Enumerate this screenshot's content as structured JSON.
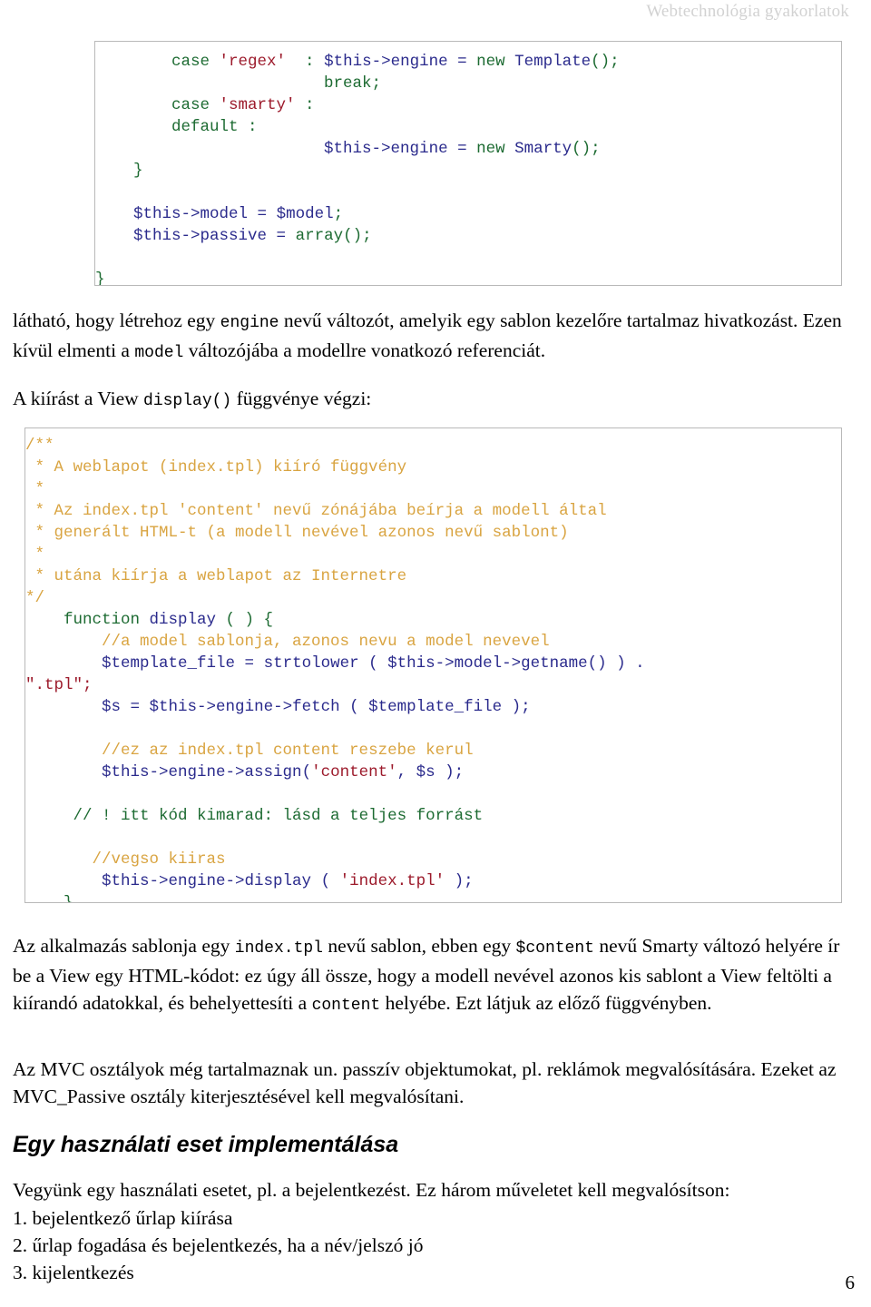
{
  "header": {
    "title": "Webtechnológia gyakorlatok"
  },
  "code_block_1": {
    "lines": [
      [
        {
          "t": "        ",
          "c": "pl"
        },
        {
          "t": "case ",
          "c": "kw"
        },
        {
          "t": "'regex'",
          "c": "str"
        },
        {
          "t": "  : ",
          "c": "kw"
        },
        {
          "t": "$this->engine",
          "c": "var"
        },
        {
          "t": " = ",
          "c": "pl"
        },
        {
          "t": "new ",
          "c": "kw"
        },
        {
          "t": "Template",
          "c": "var"
        },
        {
          "t": "();",
          "c": "kw"
        }
      ],
      [
        {
          "t": "                        ",
          "c": "pl"
        },
        {
          "t": "break;",
          "c": "kw"
        }
      ],
      [
        {
          "t": "        ",
          "c": "pl"
        },
        {
          "t": "case ",
          "c": "kw"
        },
        {
          "t": "'smarty'",
          "c": "str"
        },
        {
          "t": " :",
          "c": "kw"
        }
      ],
      [
        {
          "t": "        ",
          "c": "pl"
        },
        {
          "t": "default :",
          "c": "kw"
        }
      ],
      [
        {
          "t": "                        ",
          "c": "pl"
        },
        {
          "t": "$this->engine",
          "c": "var"
        },
        {
          "t": " = ",
          "c": "pl"
        },
        {
          "t": "new ",
          "c": "kw"
        },
        {
          "t": "Smarty",
          "c": "var"
        },
        {
          "t": "();",
          "c": "kw"
        }
      ],
      [
        {
          "t": "    }",
          "c": "kw"
        }
      ],
      [
        {
          "t": "",
          "c": "pl"
        }
      ],
      [
        {
          "t": "    ",
          "c": "pl"
        },
        {
          "t": "$this->model",
          "c": "var"
        },
        {
          "t": " = ",
          "c": "pl"
        },
        {
          "t": "$model",
          "c": "var"
        },
        {
          "t": ";",
          "c": "kw"
        }
      ],
      [
        {
          "t": "    ",
          "c": "pl"
        },
        {
          "t": "$this->passive",
          "c": "var"
        },
        {
          "t": " = ",
          "c": "pl"
        },
        {
          "t": "array",
          "c": "kw"
        },
        {
          "t": "();",
          "c": "kw"
        }
      ],
      [
        {
          "t": "",
          "c": "pl"
        }
      ],
      [
        {
          "t": "}",
          "c": "kw"
        }
      ]
    ]
  },
  "paragraph_1": {
    "segments": [
      {
        "t": "látható, hogy létrehoz egy ",
        "c": "text"
      },
      {
        "t": "engine",
        "c": "code"
      },
      {
        "t": " nevű változót, amelyik egy sablon kezelőre tartalmaz hivatkozást. Ezen kívül elmenti a ",
        "c": "text"
      },
      {
        "t": "model",
        "c": "code"
      },
      {
        "t": " változójába a modellre vonatkozó referenciát.",
        "c": "text"
      }
    ]
  },
  "paragraph_2": {
    "segments": [
      {
        "t": "A kiírást a View ",
        "c": "text"
      },
      {
        "t": "display()",
        "c": "code"
      },
      {
        "t": " függvénye végzi:",
        "c": "text"
      }
    ]
  },
  "code_block_2": {
    "lines": [
      [
        {
          "t": "/**",
          "c": "com"
        }
      ],
      [
        {
          "t": " * A weblapot (index.tpl) kiíró függvény",
          "c": "com"
        }
      ],
      [
        {
          "t": " *",
          "c": "com"
        }
      ],
      [
        {
          "t": " * Az index.tpl 'content' nevű zónájába beírja a modell által",
          "c": "com"
        }
      ],
      [
        {
          "t": " * generált HTML-t (a modell nevével azonos nevű sablont)",
          "c": "com"
        }
      ],
      [
        {
          "t": " *",
          "c": "com"
        }
      ],
      [
        {
          "t": " * utána kiírja a weblapot az Internetre",
          "c": "com"
        }
      ],
      [
        {
          "t": "*/",
          "c": "com"
        }
      ],
      [
        {
          "t": "    ",
          "c": "pl"
        },
        {
          "t": "function ",
          "c": "kw"
        },
        {
          "t": "display",
          "c": "var"
        },
        {
          "t": " ( ) {",
          "c": "kw"
        }
      ],
      [
        {
          "t": "        ",
          "c": "pl"
        },
        {
          "t": "//a model sablonja, azonos nevu a model nevevel",
          "c": "com"
        }
      ],
      [
        {
          "t": "        ",
          "c": "pl"
        },
        {
          "t": "$template_file",
          "c": "var"
        },
        {
          "t": " = ",
          "c": "pl"
        },
        {
          "t": "strtolower",
          "c": "var"
        },
        {
          "t": " ( ",
          "c": "pl"
        },
        {
          "t": "$this->model->getname",
          "c": "var"
        },
        {
          "t": "() ) .",
          "c": "pl"
        }
      ],
      [
        {
          "t": "\".tpl\";",
          "c": "str"
        }
      ],
      [
        {
          "t": "        ",
          "c": "pl"
        },
        {
          "t": "$s",
          "c": "var"
        },
        {
          "t": " = ",
          "c": "pl"
        },
        {
          "t": "$this->engine->fetch",
          "c": "var"
        },
        {
          "t": " ( ",
          "c": "pl"
        },
        {
          "t": "$template_file",
          "c": "var"
        },
        {
          "t": " );",
          "c": "pl"
        }
      ],
      [
        {
          "t": "",
          "c": "pl"
        }
      ],
      [
        {
          "t": "        ",
          "c": "pl"
        },
        {
          "t": "//ez az index.tpl content reszebe kerul",
          "c": "com"
        }
      ],
      [
        {
          "t": "        ",
          "c": "pl"
        },
        {
          "t": "$this->engine->assign",
          "c": "var"
        },
        {
          "t": "(",
          "c": "pl"
        },
        {
          "t": "'content'",
          "c": "str"
        },
        {
          "t": ", ",
          "c": "pl"
        },
        {
          "t": "$s",
          "c": "var"
        },
        {
          "t": " );",
          "c": "pl"
        }
      ],
      [
        {
          "t": "",
          "c": "pl"
        }
      ],
      [
        {
          "t": "     ",
          "c": "pl"
        },
        {
          "t": "// ! itt kód kimarad: lásd a teljes forrást",
          "c": "com2"
        }
      ],
      [
        {
          "t": "",
          "c": "pl"
        }
      ],
      [
        {
          "t": "       ",
          "c": "pl"
        },
        {
          "t": "//vegso kiiras",
          "c": "com"
        }
      ],
      [
        {
          "t": "        ",
          "c": "pl"
        },
        {
          "t": "$this->engine->display",
          "c": "var"
        },
        {
          "t": " ( ",
          "c": "pl"
        },
        {
          "t": "'index.tpl'",
          "c": "str"
        },
        {
          "t": " );",
          "c": "pl"
        }
      ],
      [
        {
          "t": "    }",
          "c": "kw"
        }
      ]
    ]
  },
  "paragraph_3": {
    "segments": [
      {
        "t": "Az alkalmazás sablonja egy ",
        "c": "text"
      },
      {
        "t": "index.tpl",
        "c": "code"
      },
      {
        "t": " nevű sablon, ebben egy ",
        "c": "text"
      },
      {
        "t": "$content",
        "c": "code"
      },
      {
        "t": " nevű Smarty változó helyére ír be a View egy  HTML-kódot: ez úgy áll össze, hogy a modell nevével azonos kis sablont a View feltölti a kiírandó adatokkal, és behelyettesíti a ",
        "c": "text"
      },
      {
        "t": "content",
        "c": "code"
      },
      {
        "t": " helyébe. Ezt látjuk az előző függvényben.",
        "c": "text"
      }
    ]
  },
  "paragraph_4": {
    "segments": [
      {
        "t": "Az MVC osztályok még tartalmaznak un. passzív objektumokat, pl. reklámok megvalósítására. Ezeket az MVC_Passive osztály kiterjesztésével kell megvalósítani.",
        "c": "text"
      }
    ]
  },
  "section_heading": {
    "text": "Egy használati eset implementálása"
  },
  "paragraph_5": {
    "segments": [
      {
        "t": "Vegyünk egy használati esetet, pl. a bejelentkezést. Ez három műveletet kell megvalósítson:",
        "c": "text"
      }
    ]
  },
  "numbered_list": {
    "items": [
      "1. bejelentkező űrlap kiírása",
      "2. űrlap fogadása és bejelentkezés, ha a név/jelszó jó",
      "3. kijelentkezés"
    ]
  },
  "page_number": {
    "text": "6"
  },
  "colors": {
    "keyword": "#1d6b32",
    "string": "#9c1a2b",
    "variable": "#2a2a8c",
    "comment": "#d9a441",
    "comment_alt": "#1d6b32",
    "header_text": "#d2d2d2",
    "code_border": "#b9b9b9",
    "body_text": "#000000"
  }
}
